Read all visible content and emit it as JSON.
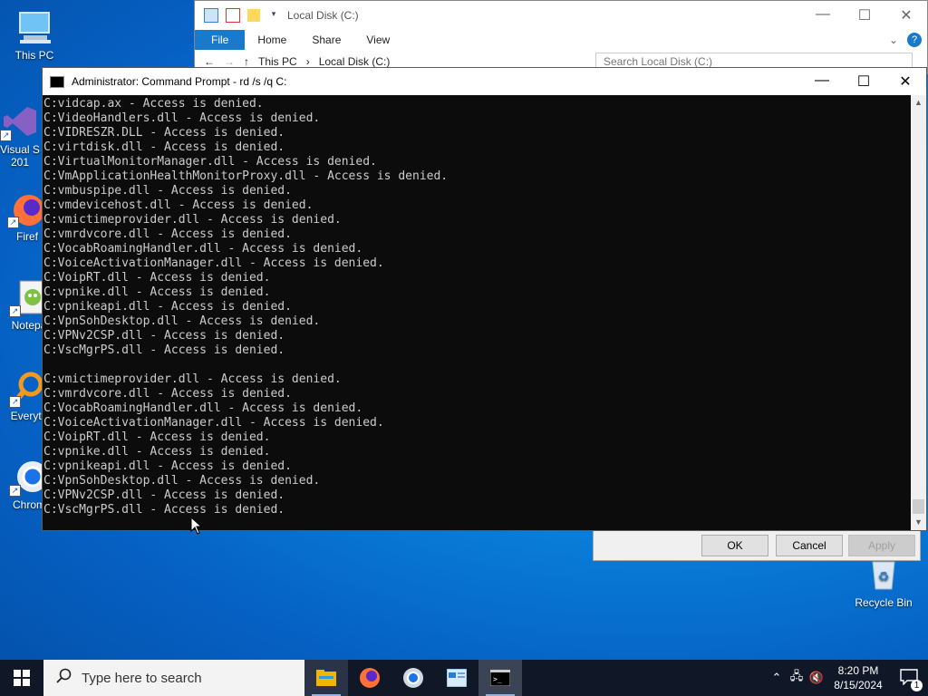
{
  "desktop": {
    "icons": [
      {
        "label": "This PC"
      },
      {
        "label": "Visual S\n201"
      },
      {
        "label": "Firef"
      },
      {
        "label": "Notepa"
      },
      {
        "label": "Everyth"
      },
      {
        "label": "Chrom"
      }
    ],
    "recycle_bin": "Recycle Bin"
  },
  "explorer": {
    "title": "Local Disk (C:)",
    "tabs": [
      "File",
      "Home",
      "Share",
      "View"
    ],
    "breadcrumb": [
      "This PC",
      "Local Disk (C:)"
    ],
    "search_placeholder": "Search Local Disk (C:)",
    "help": "?"
  },
  "properties_dialog": {
    "ok": "OK",
    "cancel": "Cancel",
    "apply": "Apply"
  },
  "cmd": {
    "title": "Administrator: Command Prompt - rd  /s /q C:",
    "lines": [
      "C:vidcap.ax - Access is denied.",
      "C:VideoHandlers.dll - Access is denied.",
      "C:VIDRESZR.DLL - Access is denied.",
      "C:virtdisk.dll - Access is denied.",
      "C:VirtualMonitorManager.dll - Access is denied.",
      "C:VmApplicationHealthMonitorProxy.dll - Access is denied.",
      "C:vmbuspipe.dll - Access is denied.",
      "C:vmdevicehost.dll - Access is denied.",
      "C:vmictimeprovider.dll - Access is denied.",
      "C:vmrdvcore.dll - Access is denied.",
      "C:VocabRoamingHandler.dll - Access is denied.",
      "C:VoiceActivationManager.dll - Access is denied.",
      "C:VoipRT.dll - Access is denied.",
      "C:vpnike.dll - Access is denied.",
      "C:vpnikeapi.dll - Access is denied.",
      "C:VpnSohDesktop.dll - Access is denied.",
      "C:VPNv2CSP.dll - Access is denied.",
      "C:VscMgrPS.dll - Access is denied.",
      "",
      "C:vmictimeprovider.dll - Access is denied.",
      "C:vmrdvcore.dll - Access is denied.",
      "C:VocabRoamingHandler.dll - Access is denied.",
      "C:VoiceActivationManager.dll - Access is denied.",
      "C:VoipRT.dll - Access is denied.",
      "C:vpnike.dll - Access is denied.",
      "C:vpnikeapi.dll - Access is denied.",
      "C:VpnSohDesktop.dll - Access is denied.",
      "C:VPNv2CSP.dll - Access is denied.",
      "C:VscMgrPS.dll - Access is denied."
    ]
  },
  "taskbar": {
    "search_placeholder": "Type here to search",
    "apps": [
      "file-explorer",
      "firefox",
      "chrome",
      "app",
      "command-prompt"
    ],
    "time": "8:20 PM",
    "date": "8/15/2024",
    "notification_count": "1"
  },
  "colors": {
    "console_bg": "#0c0c0c",
    "console_fg": "#cccccc",
    "accent": "#1979ca",
    "taskbar": "#101828"
  }
}
